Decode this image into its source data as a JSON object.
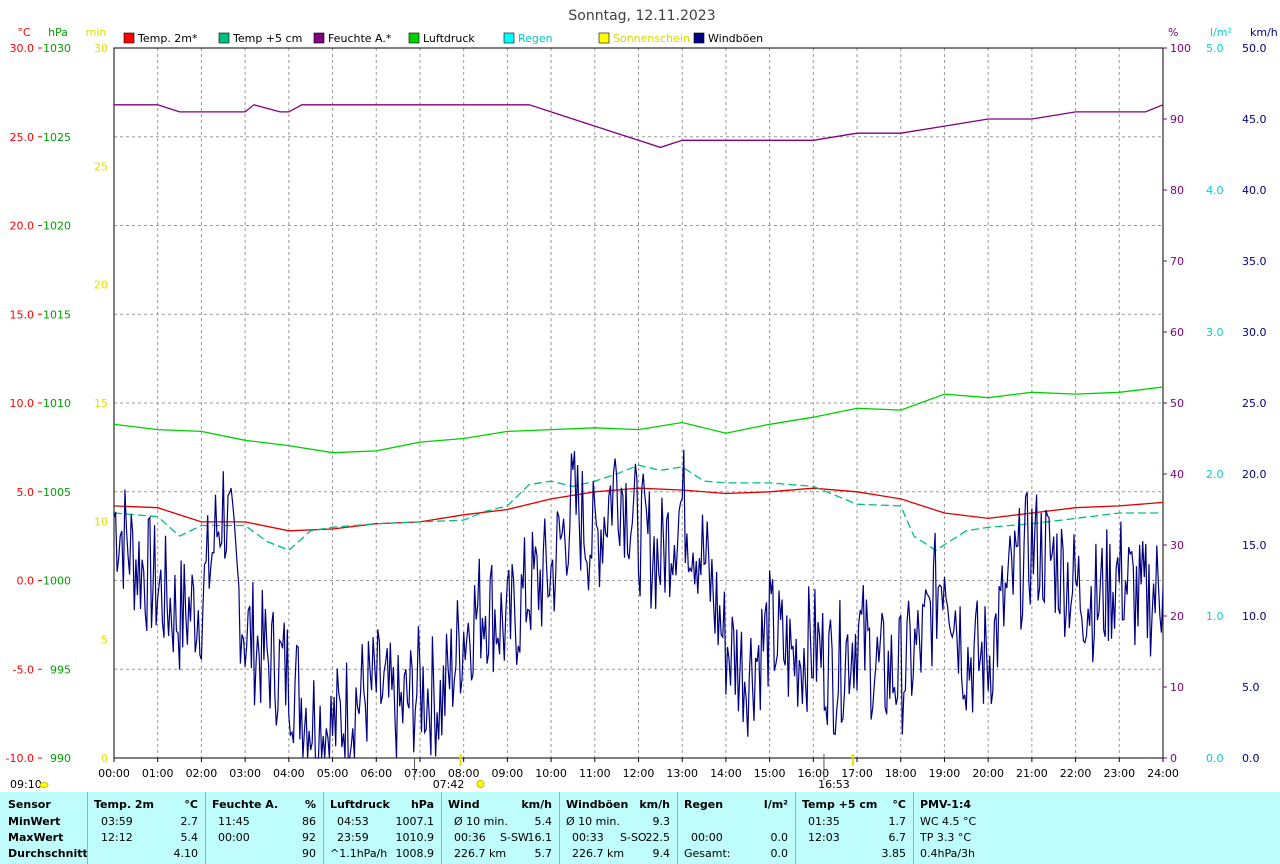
{
  "chart_data": {
    "type": "line",
    "title": "Sonntag, 12.11.2023",
    "x_ticks": [
      "00:00",
      "01:00",
      "02:00",
      "03:00",
      "04:00",
      "05:00",
      "06:00",
      "07:00",
      "08:00",
      "09:00",
      "10:00",
      "11:00",
      "12:00",
      "13:00",
      "14:00",
      "15:00",
      "16:00",
      "17:00",
      "18:00",
      "19:00",
      "20:00",
      "21:00",
      "22:00",
      "23:00",
      "24:00"
    ],
    "grid": true,
    "legend_position": "top",
    "legend": [
      {
        "name": "Temp. 2m*",
        "color": "#ff0000"
      },
      {
        "name": "Temp +5 cm",
        "color": "#00c080"
      },
      {
        "name": "Feuchte A.*",
        "color": "#800080"
      },
      {
        "name": "Luftdruck",
        "color": "#00d000"
      },
      {
        "name": "Regen",
        "color": "#00ffff"
      },
      {
        "name": "Sonnenschein",
        "color": "#ffff00"
      },
      {
        "name": "Windböen",
        "color": "#000080"
      }
    ],
    "axes": [
      {
        "label": "°C",
        "color": "#ff0000",
        "min": -10,
        "max": 30,
        "ticks": [
          "30.0",
          "25.0",
          "20.0",
          "15.0",
          "10.0",
          "5.0",
          "0.0",
          "-5.0",
          "-10.0"
        ]
      },
      {
        "label": "hPa",
        "color": "#00a000",
        "min": 990,
        "max": 1030,
        "ticks": [
          "1030",
          "1025",
          "1020",
          "1015",
          "1010",
          "1005",
          "1000",
          "995",
          "990"
        ]
      },
      {
        "label": "min",
        "color": "#e0e000",
        "min": 0,
        "max": 30,
        "ticks": [
          "30",
          "25",
          "20",
          "15",
          "10",
          "5",
          "0"
        ]
      },
      {
        "label": "%",
        "color": "#800080",
        "min": 0,
        "max": 100,
        "ticks": [
          "100",
          "90",
          "80",
          "70",
          "60",
          "50",
          "40",
          "30",
          "20",
          "10",
          "0"
        ]
      },
      {
        "label": "l/m²",
        "color": "#00d0d0",
        "min": 0,
        "max": 5,
        "ticks": [
          "5.0",
          "4.0",
          "3.0",
          "2.0",
          "1.0",
          "0.0"
        ]
      },
      {
        "label": "km/h",
        "color": "#000080",
        "min": 0,
        "max": 50,
        "ticks": [
          "50.0",
          "45.0",
          "40.0",
          "35.0",
          "30.0",
          "25.0",
          "20.0",
          "15.0",
          "10.0",
          "5.0",
          "0.0"
        ]
      }
    ],
    "series": [
      {
        "name": "Temp. 2m*",
        "unit": "°C",
        "x_hours": [
          0,
          1,
          2,
          3,
          4,
          5,
          6,
          7,
          8,
          9,
          10,
          11,
          12,
          13,
          14,
          15,
          16,
          17,
          18,
          19,
          20,
          21,
          22,
          23,
          24
        ],
        "values": [
          4.2,
          4.1,
          3.3,
          3.3,
          2.8,
          2.9,
          3.2,
          3.3,
          3.7,
          4.0,
          4.6,
          5.0,
          5.2,
          5.1,
          4.9,
          5.0,
          5.2,
          5.0,
          4.6,
          3.8,
          3.5,
          3.8,
          4.1,
          4.2,
          4.4
        ]
      },
      {
        "name": "Temp +5 cm",
        "unit": "°C",
        "x_hours": [
          0,
          1,
          1.5,
          2,
          3,
          3.5,
          4,
          4.5,
          5,
          6,
          7,
          8,
          8.5,
          9,
          9.5,
          10,
          10.5,
          11,
          11.5,
          12,
          12.5,
          13,
          13.5,
          14,
          15,
          16,
          17,
          18,
          18.3,
          18.8,
          19.5,
          20,
          21,
          22,
          23,
          24
        ],
        "values": [
          3.8,
          3.6,
          2.5,
          3.1,
          3.1,
          2.2,
          1.7,
          2.8,
          3.0,
          3.2,
          3.3,
          3.4,
          3.9,
          4.2,
          5.4,
          5.6,
          5.3,
          5.6,
          6.0,
          6.5,
          6.2,
          6.4,
          5.6,
          5.5,
          5.5,
          5.3,
          4.3,
          4.2,
          2.5,
          1.7,
          2.8,
          3.0,
          3.2,
          3.5,
          3.8,
          3.8
        ]
      },
      {
        "name": "Feuchte A.*",
        "unit": "%",
        "x_hours": [
          0,
          1,
          1.5,
          2,
          3,
          3.2,
          3.8,
          4,
          4.3,
          5,
          6,
          7,
          8,
          9,
          9.5,
          10,
          10.5,
          11,
          11.5,
          12,
          12.5,
          13,
          14,
          15,
          16,
          17,
          18,
          19,
          20,
          21,
          22,
          23,
          23.6,
          24
        ],
        "values": [
          92,
          92,
          91,
          91,
          91,
          92,
          91,
          91,
          92,
          92,
          92,
          92,
          92,
          92,
          92,
          91,
          90,
          89,
          88,
          87,
          86,
          87,
          87,
          87,
          87,
          88,
          88,
          89,
          90,
          90,
          91,
          91,
          91,
          92
        ]
      },
      {
        "name": "Luftdruck",
        "unit": "hPa",
        "x_hours": [
          0,
          1,
          2,
          3,
          4,
          5,
          6,
          7,
          8,
          9,
          10,
          11,
          12,
          13,
          14,
          15,
          16,
          17,
          18,
          19,
          20,
          21,
          22,
          23,
          24
        ],
        "values": [
          1008.8,
          1008.5,
          1008.4,
          1007.9,
          1007.6,
          1007.2,
          1007.3,
          1007.8,
          1008.0,
          1008.4,
          1008.5,
          1008.6,
          1008.5,
          1008.9,
          1008.3,
          1008.8,
          1009.2,
          1009.7,
          1009.6,
          1010.5,
          1010.3,
          1010.6,
          1010.5,
          1010.6,
          1010.9
        ]
      },
      {
        "name": "Windböen",
        "unit": "km/h",
        "x_hours": [
          0,
          0.5,
          1,
          1.5,
          2,
          2.5,
          3,
          3.5,
          4,
          4.5,
          5,
          5.5,
          6,
          6.5,
          7,
          7.5,
          8,
          8.5,
          9,
          9.5,
          10,
          10.5,
          11,
          11.5,
          12,
          12.5,
          13,
          13.5,
          14,
          14.5,
          15,
          15.5,
          16,
          16.5,
          17,
          17.5,
          18,
          18.5,
          19,
          19.5,
          20,
          20.5,
          21,
          21.5,
          22,
          22.5,
          23,
          23.5,
          24
        ],
        "values": [
          17,
          14,
          12,
          10,
          11,
          18,
          9,
          7,
          6,
          3,
          2,
          4,
          5,
          3,
          5,
          4,
          9,
          11,
          9,
          12,
          13,
          18,
          15,
          20,
          16,
          14,
          18,
          14,
          8,
          6,
          9,
          7,
          8,
          6,
          9,
          6,
          6,
          8,
          14,
          7,
          7,
          12,
          15,
          14,
          12,
          11,
          13,
          11,
          12
        ]
      }
    ],
    "markers": {
      "sunrise": "07:42",
      "sunset": "16:53",
      "left_time": "09:10"
    }
  },
  "stats": {
    "sensor": {
      "title": "Sensor",
      "rows": [
        "MinWert",
        "MaxWert",
        "Durchschnitt"
      ]
    },
    "temp2m": {
      "title": "Temp. 2m",
      "unit": "°C",
      "min_time": "03:59",
      "min": "2.7",
      "max_time": "12:12",
      "max": "5.4",
      "avg": "4.10"
    },
    "feuchte": {
      "title": "Feuchte A.",
      "unit": "%",
      "min_time": "11:45",
      "min": "86",
      "max_time": "00:00",
      "max": "92",
      "avg": "90"
    },
    "luftdruck": {
      "title": "Luftdruck",
      "unit": "hPa",
      "min_time": "04:53",
      "min": "1007.1",
      "max_time": "23:59",
      "max": "1010.9",
      "trend": "^1.1hPa/h",
      "avg": "1008.9"
    },
    "wind": {
      "title": "Wind",
      "unit": "km/h",
      "r1a": "Ø 10 min.",
      "r1b": "5.4",
      "r2a": "00:36",
      "r2dir": "S-SW",
      "r2b": "16.1",
      "r3a": "226.7 km",
      "r3b": "5.7"
    },
    "windboen": {
      "title": "Windböen",
      "unit": "km/h",
      "r1a": "Ø 10 min.",
      "r1b": "9.3",
      "r2a": "00:33",
      "r2dir": "S-SO",
      "r2b": "22.5",
      "r3a": "226.7 km",
      "r3b": "9.4"
    },
    "regen": {
      "title": "Regen",
      "unit": "l/m²",
      "r2a": "00:00",
      "r2b": "0.0",
      "r3a": "Gesamt:",
      "r3b": "0.0"
    },
    "temp5cm": {
      "title": "Temp +5 cm",
      "unit": "°C",
      "min_time": "01:35",
      "min": "1.7",
      "max_time": "12:03",
      "max": "6.7",
      "avg": "3.85"
    },
    "pmv": {
      "title": "PMV-1:4",
      "r1": "WC 4.5 °C",
      "r2": "TP 3.3 °C",
      "r3": "0.4hPa/3h"
    }
  }
}
